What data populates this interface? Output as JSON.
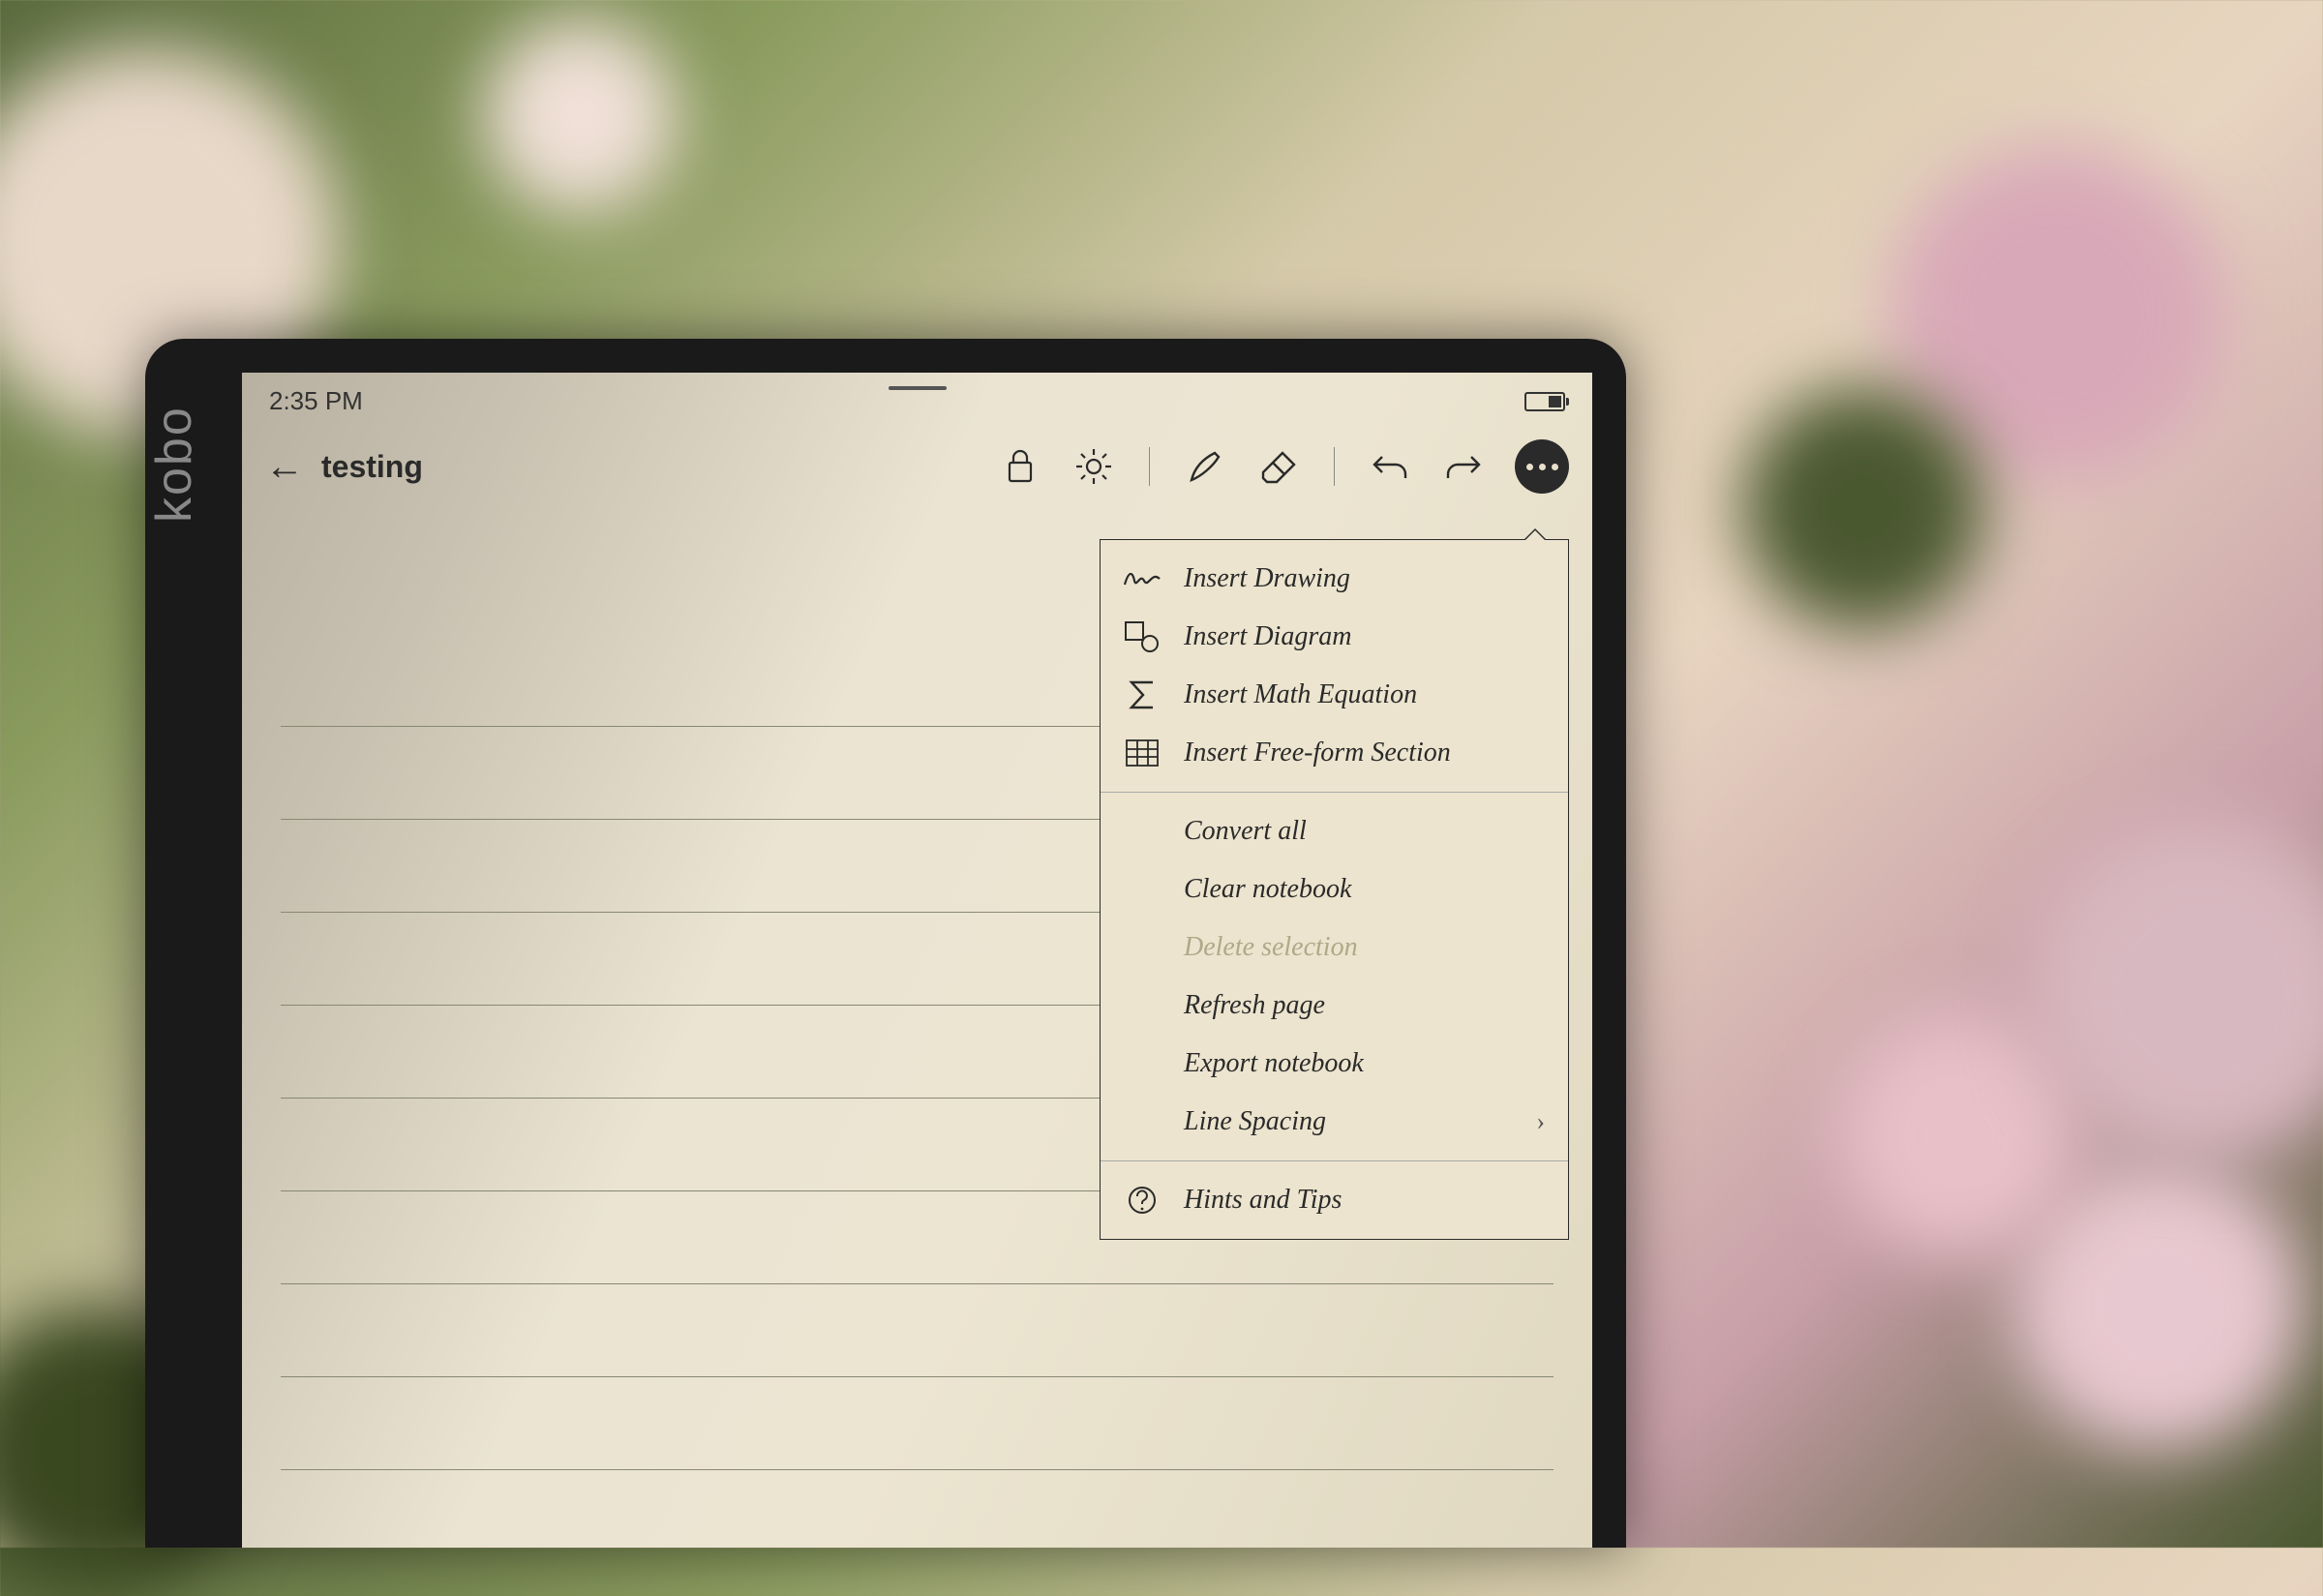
{
  "device": {
    "brand": "kobo"
  },
  "status": {
    "time": "2:35 PM"
  },
  "header": {
    "title": "testing",
    "toolbar_icons": {
      "lock": "lock-icon",
      "brightness": "brightness-icon",
      "pen": "pen-icon",
      "eraser": "eraser-icon",
      "undo": "undo-icon",
      "redo": "redo-icon",
      "more": "more-icon"
    }
  },
  "menu": {
    "groups": [
      {
        "items": [
          {
            "id": "insert-drawing",
            "label": "Insert Drawing",
            "icon": "scribble-icon"
          },
          {
            "id": "insert-diagram",
            "label": "Insert Diagram",
            "icon": "shapes-icon"
          },
          {
            "id": "insert-math",
            "label": "Insert Math Equation",
            "icon": "sigma-icon"
          },
          {
            "id": "insert-freeform",
            "label": "Insert Free-form Section",
            "icon": "grid-icon"
          }
        ]
      },
      {
        "items": [
          {
            "id": "convert-all",
            "label": "Convert all"
          },
          {
            "id": "clear-notebook",
            "label": "Clear notebook"
          },
          {
            "id": "delete-selection",
            "label": "Delete selection",
            "disabled": true
          },
          {
            "id": "refresh-page",
            "label": "Refresh page"
          },
          {
            "id": "export-notebook",
            "label": "Export notebook"
          },
          {
            "id": "line-spacing",
            "label": "Line Spacing",
            "chevron": true
          }
        ]
      },
      {
        "items": [
          {
            "id": "hints-tips",
            "label": "Hints and Tips",
            "icon": "help-icon"
          }
        ]
      }
    ]
  }
}
